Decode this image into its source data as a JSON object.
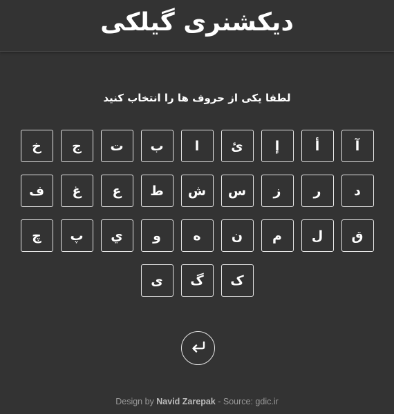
{
  "header": {
    "title": "دیکشنری گیلکی"
  },
  "prompt": "لطفا یکی از حروف ها را انتخاب کنید",
  "keyboard": {
    "rows": [
      [
        "آ",
        "أ",
        "إ",
        "ئ",
        "ا",
        "ب",
        "ت",
        "ج",
        "خ"
      ],
      [
        "د",
        "ر",
        "ز",
        "س",
        "ش",
        "ط",
        "ع",
        "غ",
        "ف"
      ],
      [
        "ق",
        "ل",
        "م",
        "ن",
        "ه",
        "و",
        "ي",
        "پ",
        "چ"
      ],
      [
        "ک",
        "گ",
        "ی"
      ]
    ]
  },
  "back_button": {
    "icon": "return-arrow-icon"
  },
  "footer": {
    "prefix": "Design by ",
    "author": "Navid Zarepak",
    "suffix": " - Source: gdic.ir"
  },
  "colors": {
    "background": "#333333",
    "text": "#ffffff",
    "key_border": "#e6e6e6",
    "footer_text": "#999999"
  }
}
